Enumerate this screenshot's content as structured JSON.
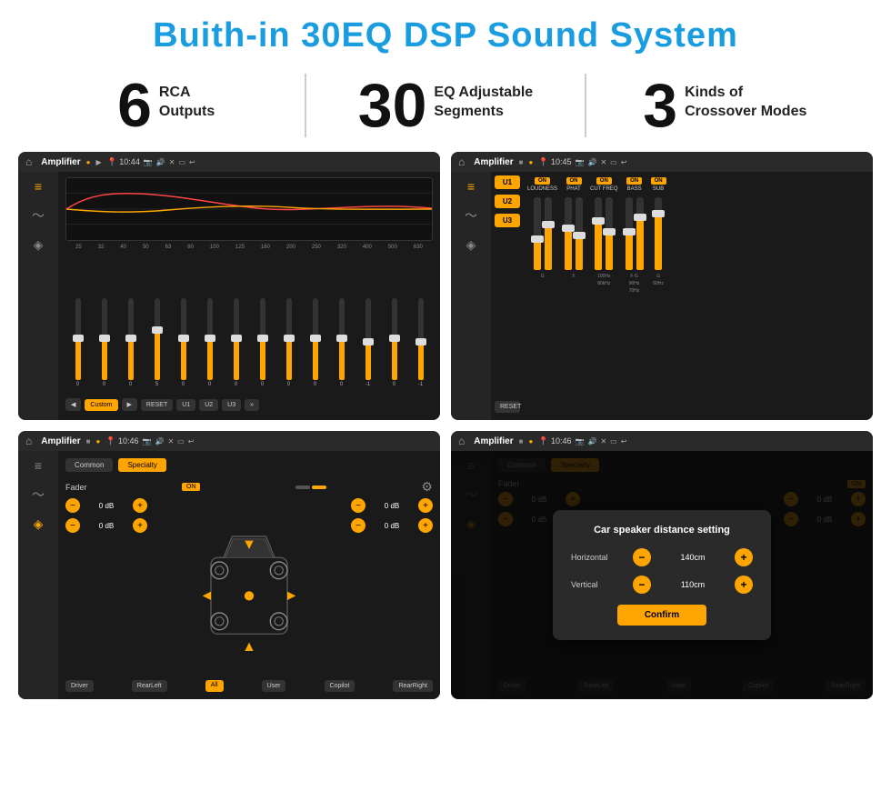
{
  "page": {
    "title": "Buith-in 30EQ DSP Sound System"
  },
  "features": [
    {
      "number": "6",
      "line1": "RCA",
      "line2": "Outputs"
    },
    {
      "number": "30",
      "line1": "EQ Adjustable",
      "line2": "Segments"
    },
    {
      "number": "3",
      "line1": "Kinds of",
      "line2": "Crossover Modes"
    }
  ],
  "screens": [
    {
      "id": "screen1",
      "status_title": "Amplifier",
      "time": "10:44",
      "eq_labels": [
        "25",
        "32",
        "40",
        "50",
        "63",
        "80",
        "100",
        "125",
        "160",
        "200",
        "250",
        "320",
        "400",
        "500",
        "630"
      ],
      "eq_values": [
        "0",
        "0",
        "0",
        "5",
        "0",
        "0",
        "0",
        "0",
        "0",
        "0",
        "0",
        "-1",
        "0",
        "-1"
      ],
      "bottom_buttons": [
        "Custom",
        "RESET",
        "U1",
        "U2",
        "U3"
      ]
    },
    {
      "id": "screen2",
      "status_title": "Amplifier",
      "time": "10:45",
      "u_buttons": [
        "U1",
        "U2",
        "U3"
      ],
      "control_groups": [
        {
          "on": true,
          "label": "LOUDNESS"
        },
        {
          "on": true,
          "label": "PHAT"
        },
        {
          "on": true,
          "label": "CUT FREQ"
        },
        {
          "on": true,
          "label": "BASS"
        },
        {
          "on": true,
          "label": "SUB"
        }
      ],
      "reset_label": "RESET"
    },
    {
      "id": "screen3",
      "status_title": "Amplifier",
      "time": "10:46",
      "tabs": [
        "Common",
        "Specialty"
      ],
      "fader_label": "Fader",
      "on_label": "ON",
      "db_rows": [
        {
          "value": "0 dB"
        },
        {
          "value": "0 dB"
        },
        {
          "value": "0 dB"
        },
        {
          "value": "0 dB"
        }
      ],
      "bottom_labels": [
        "Driver",
        "All",
        "RearLeft",
        "User",
        "RearRight"
      ],
      "copilot_label": "Copilot"
    },
    {
      "id": "screen4",
      "status_title": "Amplifier",
      "time": "10:46",
      "modal_title": "Car speaker distance setting",
      "horizontal_label": "Horizontal",
      "horizontal_value": "140cm",
      "vertical_label": "Vertical",
      "vertical_value": "110cm",
      "confirm_label": "Confirm",
      "db_rows": [
        {
          "value": "0 dB"
        },
        {
          "value": "0 dB"
        }
      ],
      "bottom_labels": [
        "Driver",
        "RearLeft",
        "User",
        "RearRight"
      ],
      "copilot_label": "Copilot"
    }
  ]
}
